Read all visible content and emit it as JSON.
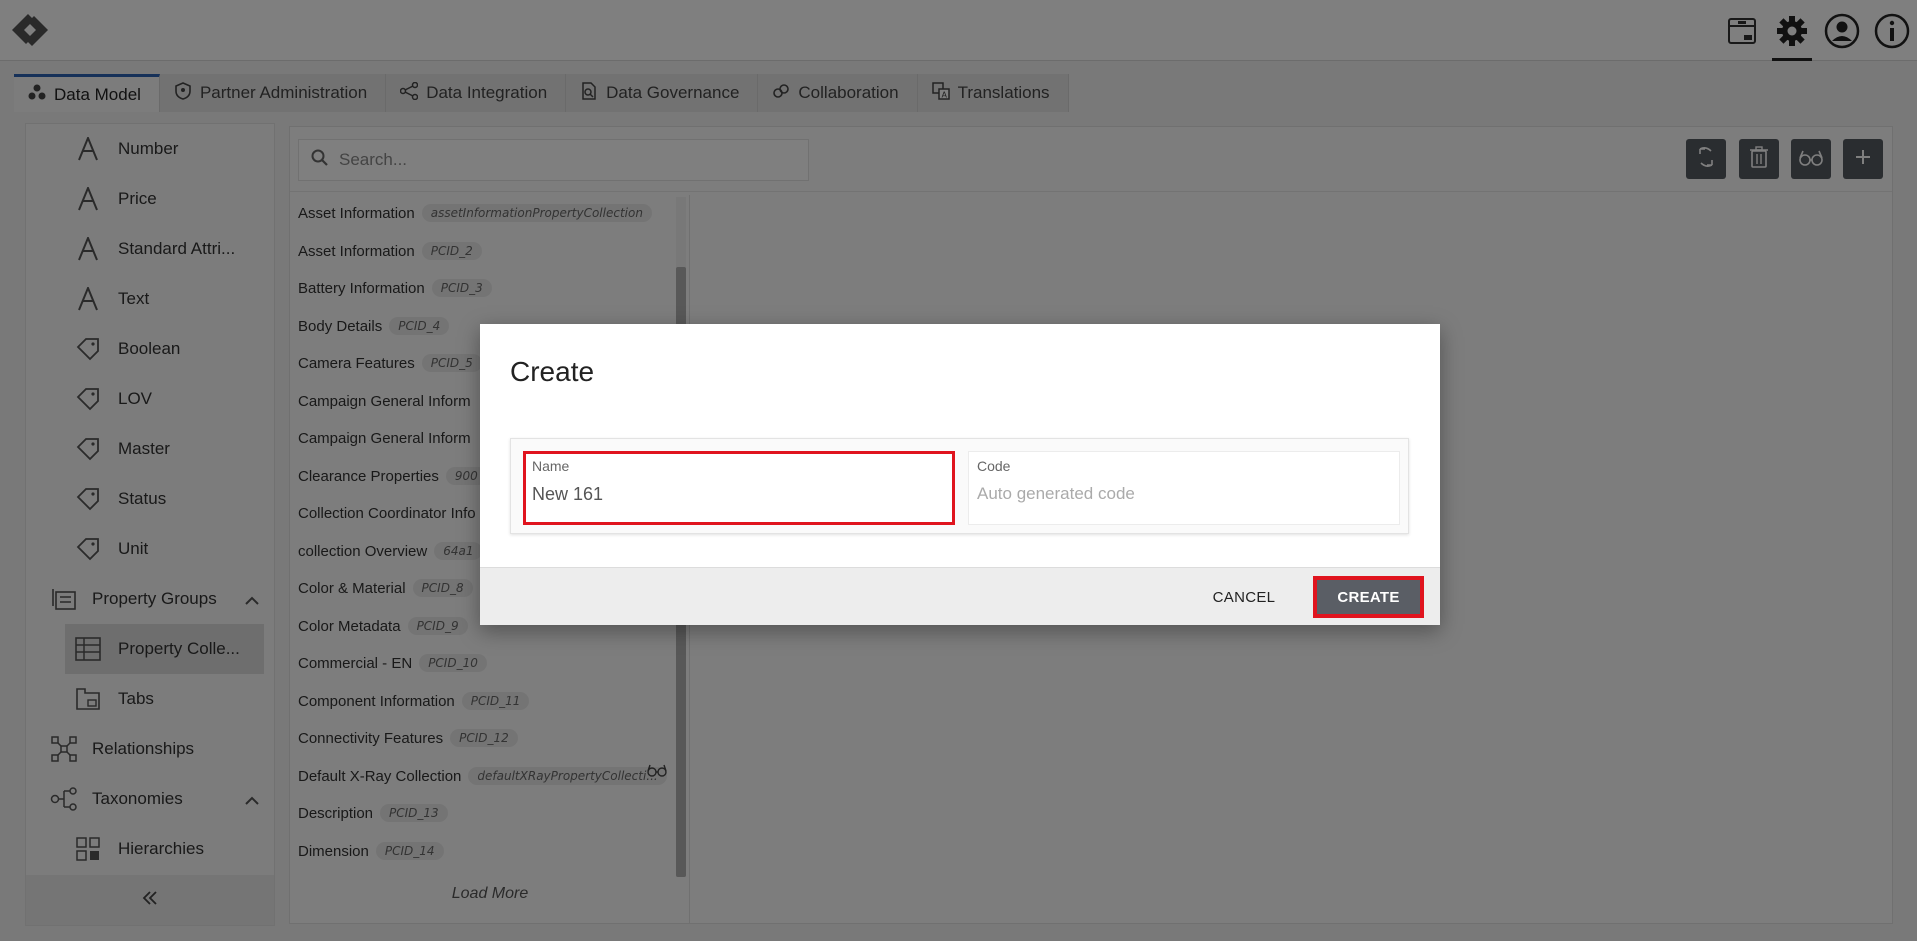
{
  "header": {
    "icons": [
      "logo-icon",
      "archive-box-icon",
      "gear-icon",
      "user-icon",
      "info-icon"
    ],
    "active_icon": "gear-icon"
  },
  "tabs": [
    {
      "label": "Data Model",
      "icon": "data-model-icon",
      "active": true
    },
    {
      "label": "Partner Administration",
      "icon": "shield-icon"
    },
    {
      "label": "Data Integration",
      "icon": "share-icon"
    },
    {
      "label": "Data Governance",
      "icon": "document-search-icon"
    },
    {
      "label": "Collaboration",
      "icon": "link-icon"
    },
    {
      "label": "Translations",
      "icon": "translate-icon"
    }
  ],
  "sidebar": {
    "items": [
      {
        "label": "Number",
        "icon": "attribute-icon"
      },
      {
        "label": "Price",
        "icon": "attribute-icon"
      },
      {
        "label": "Standard Attri...",
        "icon": "attribute-icon"
      },
      {
        "label": "Text",
        "icon": "attribute-icon"
      },
      {
        "label": "Boolean",
        "icon": "tag-icon"
      },
      {
        "label": "LOV",
        "icon": "tag-icon"
      },
      {
        "label": "Master",
        "icon": "tag-icon"
      },
      {
        "label": "Status",
        "icon": "tag-icon"
      },
      {
        "label": "Unit",
        "icon": "tag-icon"
      },
      {
        "label": "Property Groups",
        "icon": "property-groups-icon"
      },
      {
        "label": "Property Colle...",
        "icon": "table-icon",
        "selected": true
      },
      {
        "label": "Tabs",
        "icon": "tabs-icon"
      },
      {
        "label": "Relationships",
        "icon": "relationships-icon"
      },
      {
        "label": "Taxonomies",
        "icon": "taxonomy-icon"
      },
      {
        "label": "Hierarchies",
        "icon": "hierarchies-icon"
      }
    ]
  },
  "search": {
    "placeholder": "Search..."
  },
  "list": {
    "rows": [
      {
        "name": "Asset Information",
        "code": "assetInformationPropertyCollection"
      },
      {
        "name": "Asset Information",
        "code": "PCID_2"
      },
      {
        "name": "Battery Information",
        "code": "PCID_3"
      },
      {
        "name": "Body Details",
        "code": "PCID_4"
      },
      {
        "name": "Camera Features",
        "code": "PCID_5"
      },
      {
        "name": "Campaign General Inform",
        "code": ""
      },
      {
        "name": "Campaign General Inform",
        "code": ""
      },
      {
        "name": "Clearance Properties",
        "code": "900"
      },
      {
        "name": "Collection Coordinator Info",
        "code": ""
      },
      {
        "name": "collection Overview",
        "code": "64a1"
      },
      {
        "name": "Color & Material",
        "code": "PCID_8"
      },
      {
        "name": "Color Metadata",
        "code": "PCID_9"
      },
      {
        "name": "Commercial - EN",
        "code": "PCID_10"
      },
      {
        "name": "Component Information",
        "code": "PCID_11"
      },
      {
        "name": "Connectivity Features",
        "code": "PCID_12"
      },
      {
        "name": "Default X-Ray Collection",
        "code": "defaultXRayPropertyCollecti..."
      },
      {
        "name": "Description",
        "code": "PCID_13"
      },
      {
        "name": "Dimension",
        "code": "PCID_14"
      }
    ],
    "load_more": "Load More"
  },
  "toolbar": {
    "buttons": [
      "refresh-icon",
      "trash-icon",
      "glasses-icon",
      "plus-icon"
    ]
  },
  "dialog": {
    "title": "Create",
    "name_label": "Name",
    "name_value": "New 161",
    "code_label": "Code",
    "code_placeholder": "Auto generated code",
    "cancel_label": "CANCEL",
    "create_label": "CREATE"
  },
  "colors": {
    "highlight": "#e0141e",
    "active_tab": "#2c63b3",
    "button_dark": "#5a5e65"
  }
}
